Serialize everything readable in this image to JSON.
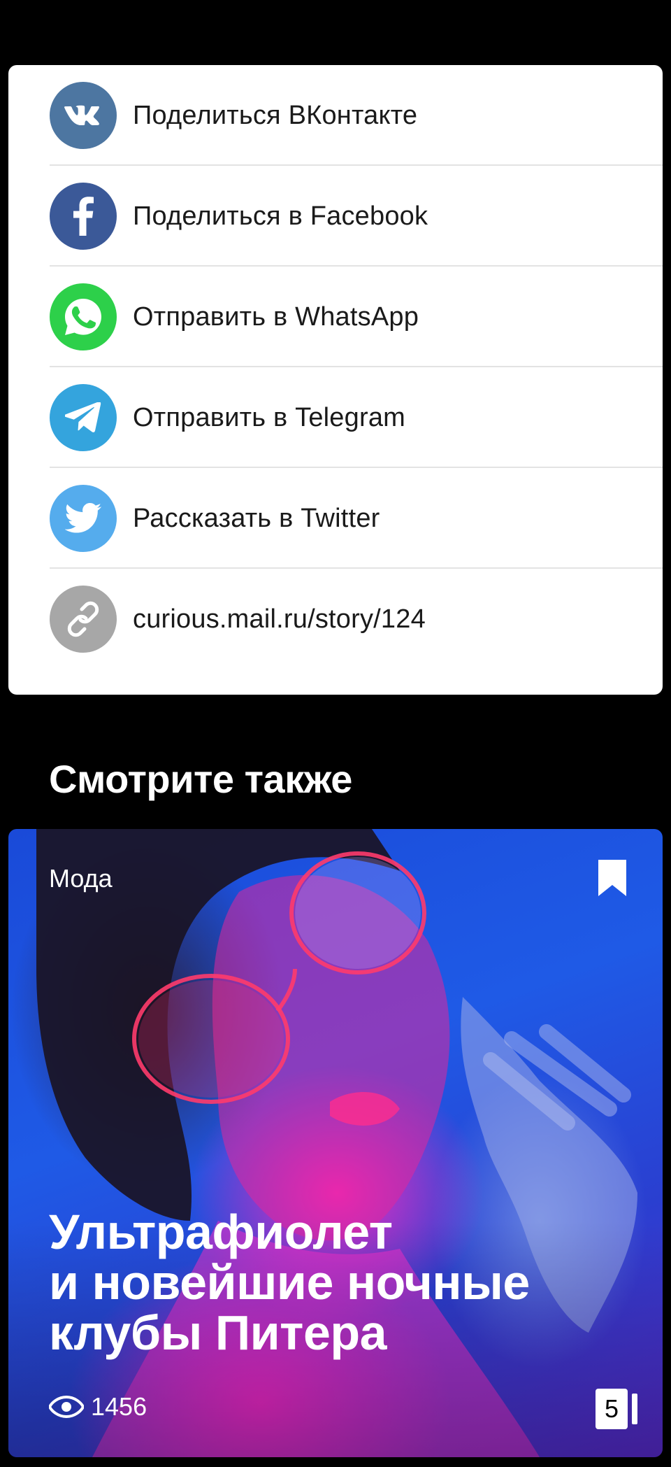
{
  "share": {
    "items": [
      {
        "label": "Поделиться ВКонтакте",
        "icon": "vk-icon",
        "color": "#4d76a1"
      },
      {
        "label": "Поделиться в Facebook",
        "icon": "facebook-icon",
        "color": "#3b5998"
      },
      {
        "label": "Отправить в WhatsApp",
        "icon": "whatsapp-icon",
        "color": "#2dd04a"
      },
      {
        "label": "Отправить в Telegram",
        "icon": "telegram-icon",
        "color": "#34a4dd"
      },
      {
        "label": "Рассказать в Twitter",
        "icon": "twitter-icon",
        "color": "#55aced"
      },
      {
        "label": "curious.mail.ru/story/124",
        "icon": "link-icon",
        "color": "#a7a7a7"
      }
    ]
  },
  "see_also": {
    "title": "Смотрите также"
  },
  "story": {
    "category": "Мода",
    "title_lines": [
      "Ультрафиолет",
      "и новейшие ночные",
      "клубы Питера"
    ],
    "views": "1456",
    "slides_count": "5",
    "icons": {
      "bookmark": "bookmark-icon",
      "views": "eye-icon"
    }
  }
}
